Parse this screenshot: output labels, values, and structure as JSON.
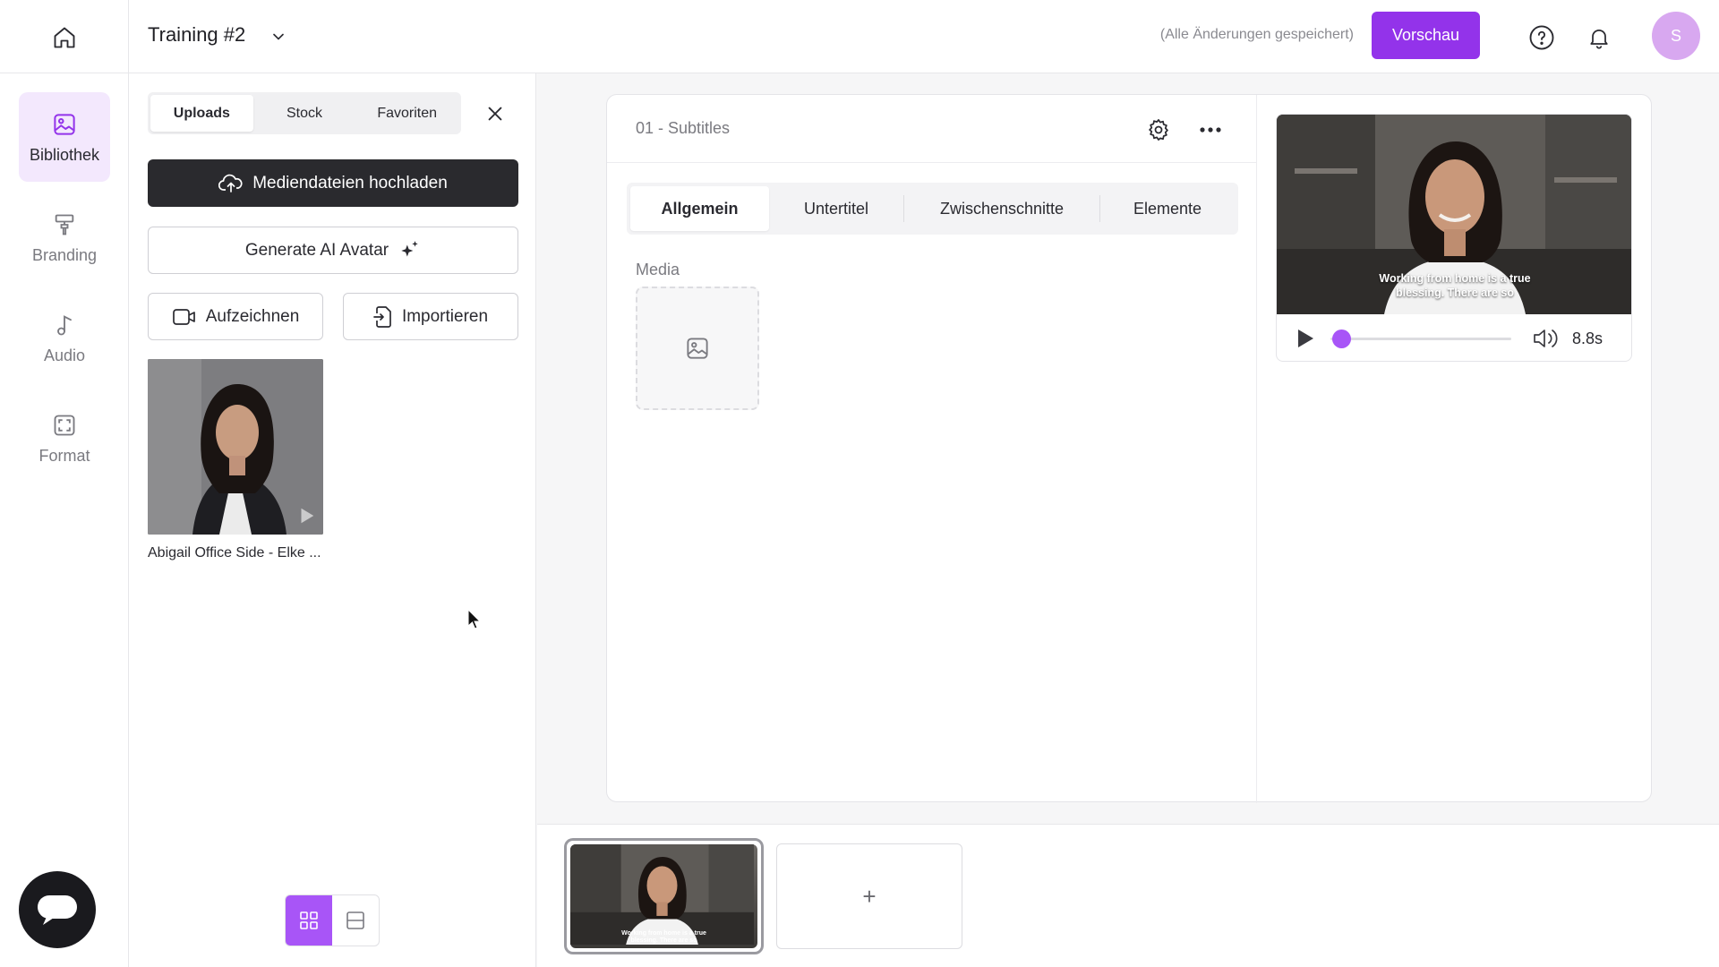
{
  "topbar": {
    "project_title": "Training #2",
    "save_status": "(Alle Änderungen gespeichert)",
    "preview_label": "Vorschau",
    "avatar_initial": "S"
  },
  "nav": {
    "items": [
      {
        "label": "Bibliothek",
        "icon": "image-icon",
        "active": true
      },
      {
        "label": "Branding",
        "icon": "paint-roller-icon",
        "active": false
      },
      {
        "label": "Audio",
        "icon": "music-note-icon",
        "active": false
      },
      {
        "label": "Format",
        "icon": "frame-icon",
        "active": false
      }
    ]
  },
  "library": {
    "tabs": [
      "Uploads",
      "Stock",
      "Favoriten"
    ],
    "active_tab": "Uploads",
    "upload_label": "Mediendateien hochladen",
    "ai_avatar_label": "Generate AI Avatar",
    "record_label": "Aufzeichnen",
    "import_label": "Importieren",
    "media_items": [
      {
        "label": "Abigail Office Side - Elke ..."
      }
    ]
  },
  "scene": {
    "title": "01 - Subtitles",
    "tabs": [
      "Allgemein",
      "Untertitel",
      "Zwischenschnitte",
      "Elemente"
    ],
    "active_tab": "Allgemein",
    "media_label": "Media"
  },
  "player": {
    "caption_line1": "Working from home is a true",
    "caption_line2": "blessing. There are so",
    "duration": "8.8s",
    "progress_fraction": 0.03
  },
  "timeline": {
    "thumb_caption_line1": "Working from home is a true",
    "thumb_caption_line2": "blessing. There are so",
    "add_label": "+"
  },
  "colors": {
    "accent": "#9333ea",
    "accent_light": "#f3e8fd",
    "dark_button": "#2a2a2e"
  }
}
